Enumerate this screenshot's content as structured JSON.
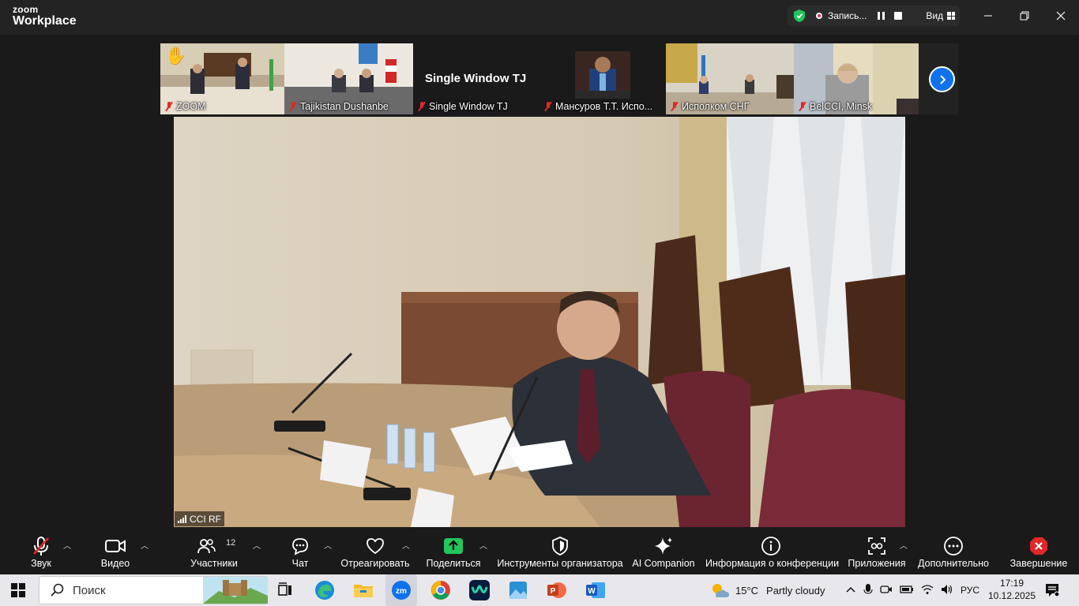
{
  "app": {
    "logo_small": "zoom",
    "logo_big": "Workplace"
  },
  "recording": {
    "label": "Запись...",
    "view_label": "Вид"
  },
  "window_controls": [
    "minimize-icon",
    "restore-icon",
    "close-icon"
  ],
  "thumbnails": [
    {
      "name": "ZOOM",
      "muted": true,
      "raised_hand": true
    },
    {
      "name": "Tajikistan Dushanbe",
      "muted": true
    },
    {
      "name": "Single Window TJ",
      "display_name": "Single Window TJ",
      "muted": true
    },
    {
      "name": "Мансуров Т.Т. Испо...",
      "muted": true
    },
    {
      "name": "Исполком СНГ",
      "muted": true
    },
    {
      "name": "BelCCI, Minsk",
      "muted": true
    }
  ],
  "main_speaker": {
    "name": "CCI RF"
  },
  "toolbar": {
    "audio": "Звук",
    "video": "Видео",
    "participants": "Участники",
    "participants_count": "12",
    "chat": "Чат",
    "react": "Отреагировать",
    "share": "Поделиться",
    "host_tools": "Инструменты организатора",
    "ai_companion": "AI Companion",
    "meeting_info": "Информация о конференции",
    "apps": "Приложения",
    "more": "Дополнительно",
    "end": "Завершение"
  },
  "taskbar": {
    "search_placeholder": "Поиск",
    "weather_temp": "15°C",
    "weather_desc": "Partly cloudy",
    "language": "РУС",
    "time": "17:19",
    "date": "10.12.2025"
  },
  "colors": {
    "accent": "#0e72ed",
    "share_green": "#22c55e",
    "end_red": "#e02828",
    "muted_red": "#e02828"
  }
}
